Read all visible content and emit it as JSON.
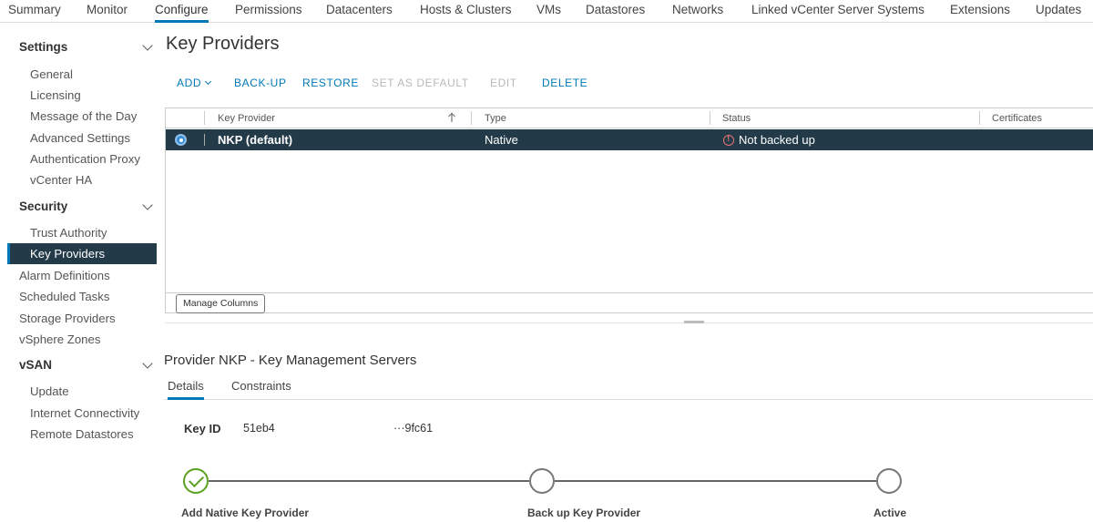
{
  "top_tabs": [
    "Summary",
    "Monitor",
    "Configure",
    "Permissions",
    "Datacenters",
    "Hosts & Clusters",
    "VMs",
    "Datastores",
    "Networks",
    "Linked vCenter Server Systems",
    "Extensions",
    "Updates"
  ],
  "active_tab": "Configure",
  "sidebar": {
    "settings_label": "Settings",
    "settings_items": [
      "General",
      "Licensing",
      "Message of the Day",
      "Advanced Settings",
      "Authentication Proxy",
      "vCenter HA"
    ],
    "security_label": "Security",
    "security_items": [
      "Trust Authority",
      "Key Providers"
    ],
    "top_items": [
      "Alarm Definitions",
      "Scheduled Tasks",
      "Storage Providers",
      "vSphere Zones"
    ],
    "vsan_label": "vSAN",
    "vsan_items": [
      "Update",
      "Internet Connectivity",
      "Remote Datastores"
    ],
    "active_item": "Key Providers"
  },
  "page": {
    "title": "Key Providers"
  },
  "toolbar": {
    "add": "ADD",
    "backup": "BACK-UP",
    "restore": "RESTORE",
    "set_default": "SET AS DEFAULT",
    "edit": "EDIT",
    "delete": "DELETE"
  },
  "grid": {
    "columns": [
      "Key Provider",
      "Type",
      "Status",
      "Certificates"
    ],
    "rows": [
      {
        "key_provider": "NKP (default)",
        "type": "Native",
        "status": "Not backed up",
        "certificates": ""
      }
    ],
    "manage_columns": "Manage Columns"
  },
  "details": {
    "title": "Provider NKP - Key Management Servers",
    "tabs": [
      "Details",
      "Constraints"
    ],
    "key_id_label": "Key ID",
    "key_id_part1": "51eb4",
    "key_id_part2": "···9fc61",
    "steps": [
      {
        "label": "Add Native Key Provider",
        "done": true
      },
      {
        "label": "Back up Key Provider",
        "done": false
      },
      {
        "label": "Active",
        "done": false
      }
    ]
  },
  "colors": {
    "accent": "#0079b8",
    "selected_row": "#233a49",
    "success": "#5aa220",
    "warning": "#e57373"
  }
}
